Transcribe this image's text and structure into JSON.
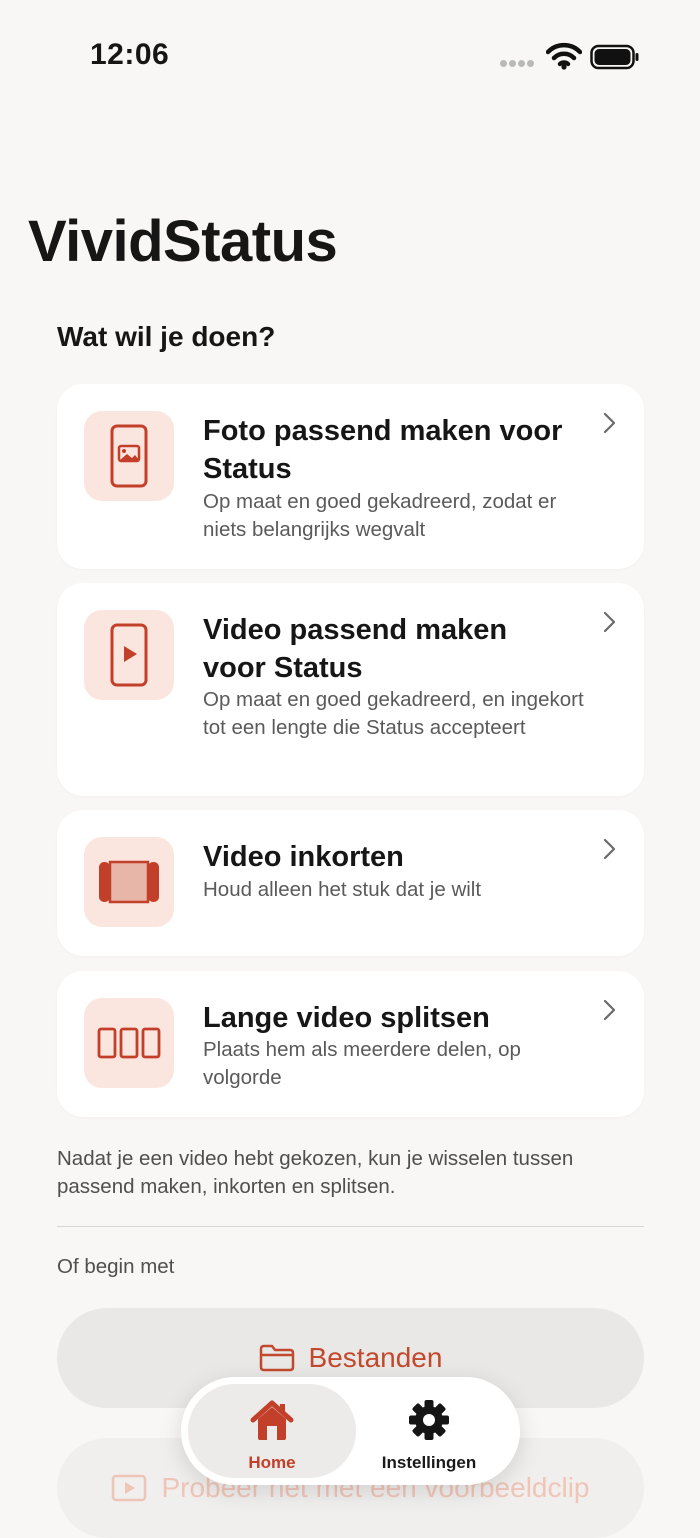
{
  "status_bar": {
    "time": "12:06"
  },
  "app_title": "VividStatus",
  "section_title": "Wat wil je doen?",
  "cards": [
    {
      "title": "Foto passend maken voor Status",
      "description": "Op maat en goed gekadreerd, zodat er niets belangrijks wegvalt",
      "icon": "phone-photo-icon"
    },
    {
      "title": "Video passend maken voor Status",
      "description": "Op maat en goed gekadreerd, en ingekort tot een lengte die Status accepteert",
      "icon": "phone-video-icon"
    },
    {
      "title": "Video inkorten",
      "description": "Houd alleen het stuk dat je wilt",
      "icon": "trim-icon"
    },
    {
      "title": "Lange video splitsen",
      "description": "Plaats hem als meerdere delen, op volgorde",
      "icon": "split-icon"
    }
  ],
  "info_text": "Nadat je een video hebt gekozen, kun je wisselen tussen passend maken, inkorten en splitsen.",
  "begin_label": "Of begin met",
  "files_button": {
    "label": "Bestanden",
    "icon": "folder-icon"
  },
  "sample_button": {
    "label": "Probeer het met een voorbeeldclip",
    "icon": "play-rect-icon"
  },
  "tab_bar": {
    "tabs": [
      {
        "label": "Home",
        "icon": "home-icon",
        "active": true
      },
      {
        "label": "Instellingen",
        "icon": "gear-icon",
        "active": false
      }
    ]
  },
  "colors": {
    "accent": "#c2402a",
    "tile_bg": "#fbe6df",
    "background": "#f8f7f5"
  }
}
